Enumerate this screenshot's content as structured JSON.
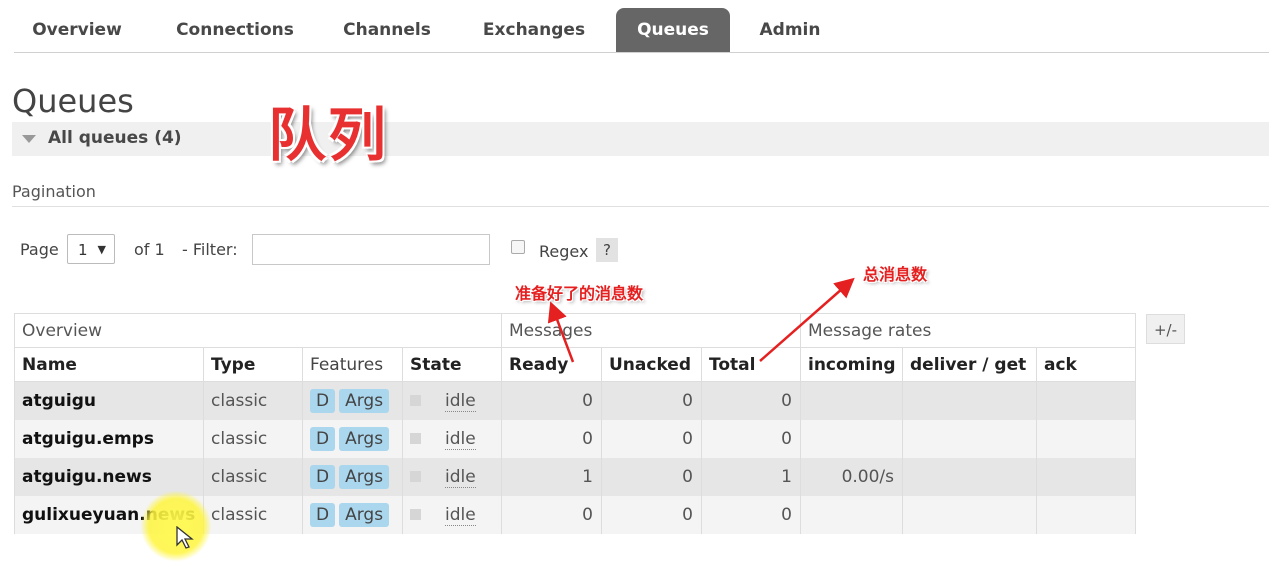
{
  "tabs": [
    {
      "label": "Overview",
      "active": false
    },
    {
      "label": "Connections",
      "active": false
    },
    {
      "label": "Channels",
      "active": false
    },
    {
      "label": "Exchanges",
      "active": false
    },
    {
      "label": "Queues",
      "active": true
    },
    {
      "label": "Admin",
      "active": false
    }
  ],
  "page_title": "Queues",
  "overlay_title": "队列",
  "section": {
    "label": "All queues (4)"
  },
  "pagination": {
    "label": "Pagination",
    "page_label": "Page",
    "page_value": "1",
    "of_label": "of 1",
    "filter_label": "- Filter:",
    "filter_value": "",
    "regex_label": "Regex",
    "help_label": "?"
  },
  "annotations": {
    "ready_note": "准备好了的消息数",
    "total_note": "总消息数"
  },
  "table": {
    "groups": [
      "Overview",
      "Messages",
      "Message rates"
    ],
    "toggle_label": "+/-",
    "columns": [
      "Name",
      "Type",
      "Features",
      "State",
      "Ready",
      "Unacked",
      "Total",
      "incoming",
      "deliver / get",
      "ack"
    ],
    "rows": [
      {
        "name": "atguigu",
        "type": "classic",
        "features": [
          "D",
          "Args"
        ],
        "state": "idle",
        "ready": "0",
        "unacked": "0",
        "total": "0",
        "incoming": "",
        "deliver_get": "",
        "ack": ""
      },
      {
        "name": "atguigu.emps",
        "type": "classic",
        "features": [
          "D",
          "Args"
        ],
        "state": "idle",
        "ready": "0",
        "unacked": "0",
        "total": "0",
        "incoming": "",
        "deliver_get": "",
        "ack": ""
      },
      {
        "name": "atguigu.news",
        "type": "classic",
        "features": [
          "D",
          "Args"
        ],
        "state": "idle",
        "ready": "1",
        "unacked": "0",
        "total": "1",
        "incoming": "0.00/s",
        "deliver_get": "",
        "ack": ""
      },
      {
        "name": "gulixueyuan.news",
        "type": "classic",
        "features": [
          "D",
          "Args"
        ],
        "state": "idle",
        "ready": "0",
        "unacked": "0",
        "total": "0",
        "incoming": "",
        "deliver_get": "",
        "ack": ""
      }
    ]
  },
  "colors": {
    "active_tab_bg": "#666666",
    "annotation_red": "#e52020",
    "feature_tag_bg": "#aad7ee"
  }
}
